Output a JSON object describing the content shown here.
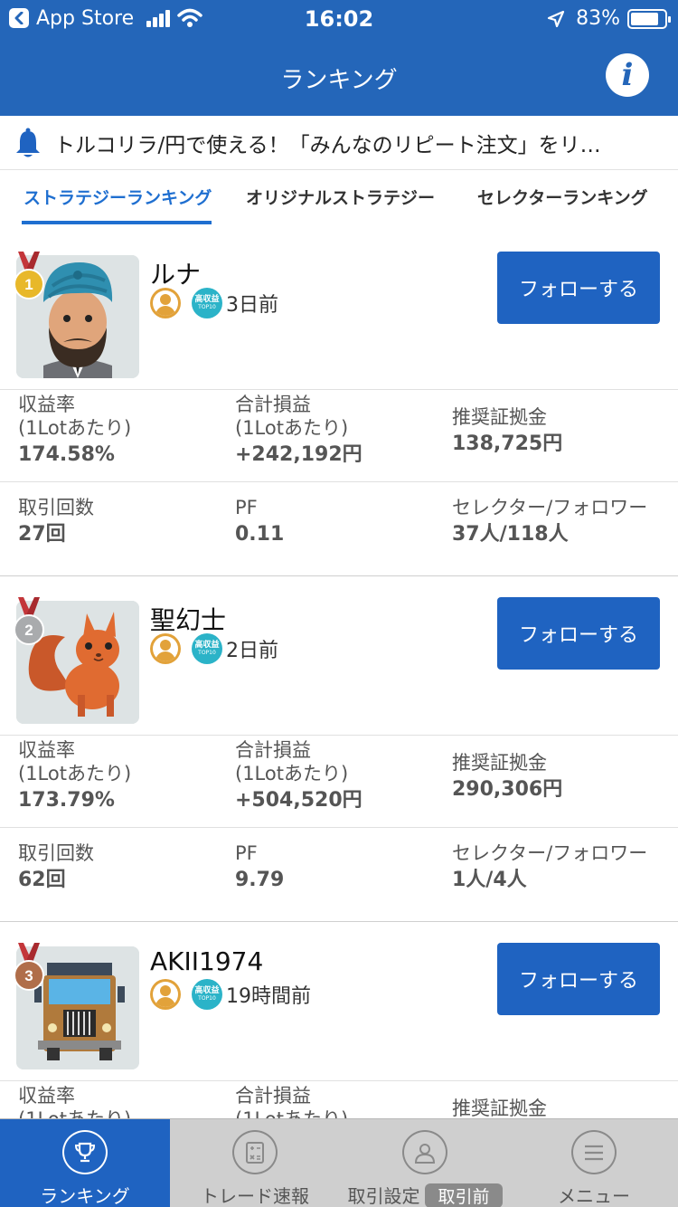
{
  "status_bar": {
    "back_app": "App Store",
    "time": "16:02",
    "battery": "83%",
    "battery_level": 0.83
  },
  "header": {
    "title": "ランキング",
    "info_icon": "i"
  },
  "notice": {
    "text": "トルコリラ/円で使える！「みんなのリピート注文」をリ…"
  },
  "tabs": [
    {
      "label": "ストラテジーランキング",
      "active": true
    },
    {
      "label": "オリジナルストラテジー",
      "active": false
    },
    {
      "label": "セレクターランキング",
      "active": false
    }
  ],
  "badge_top10": {
    "line1": "高収益",
    "line2": "TOP10"
  },
  "stat_labels": {
    "profit_rate_1": "収益率",
    "profit_rate_2": "(1Lotあたり)",
    "total_pl_1": "合計損益",
    "total_pl_2": "(1Lotあたり)",
    "margin": "推奨証拠金",
    "trades": "取引回数",
    "pf": "PF",
    "sel_fol": "セレクター/フォロワー"
  },
  "strategies": [
    {
      "rank": "1",
      "name": "ルナ",
      "updated": "3日前",
      "follow_label": "フォローする",
      "profit_rate": "174.58%",
      "total_pl": "+242,192円",
      "margin": "138,725円",
      "trades": "27回",
      "pf": "0.11",
      "sel_fol": "37人/118人"
    },
    {
      "rank": "2",
      "name": "聖幻士",
      "updated": "2日前",
      "follow_label": "フォローする",
      "profit_rate": "173.79%",
      "total_pl": "+504,520円",
      "margin": "290,306円",
      "trades": "62回",
      "pf": "9.79",
      "sel_fol": "1人/4人"
    },
    {
      "rank": "3",
      "name": "AKII1974",
      "updated": "19時間前",
      "follow_label": "フォローする"
    }
  ],
  "tabbar": {
    "items": [
      {
        "label": "ランキング",
        "icon": "trophy-icon",
        "active": true
      },
      {
        "label": "トレード速報",
        "icon": "calculator-icon",
        "active": false
      },
      {
        "label": "取引設定",
        "badge": "取引前",
        "icon": "person-icon",
        "active": false
      },
      {
        "label": "メニュー",
        "icon": "menu-icon",
        "active": false
      }
    ]
  },
  "colors": {
    "brand_blue": "#2466b9",
    "button_blue": "#1f63c1",
    "tab_active": "#1f6fd0",
    "gold": "#e2a23a",
    "teal": "#2bb3c8"
  }
}
